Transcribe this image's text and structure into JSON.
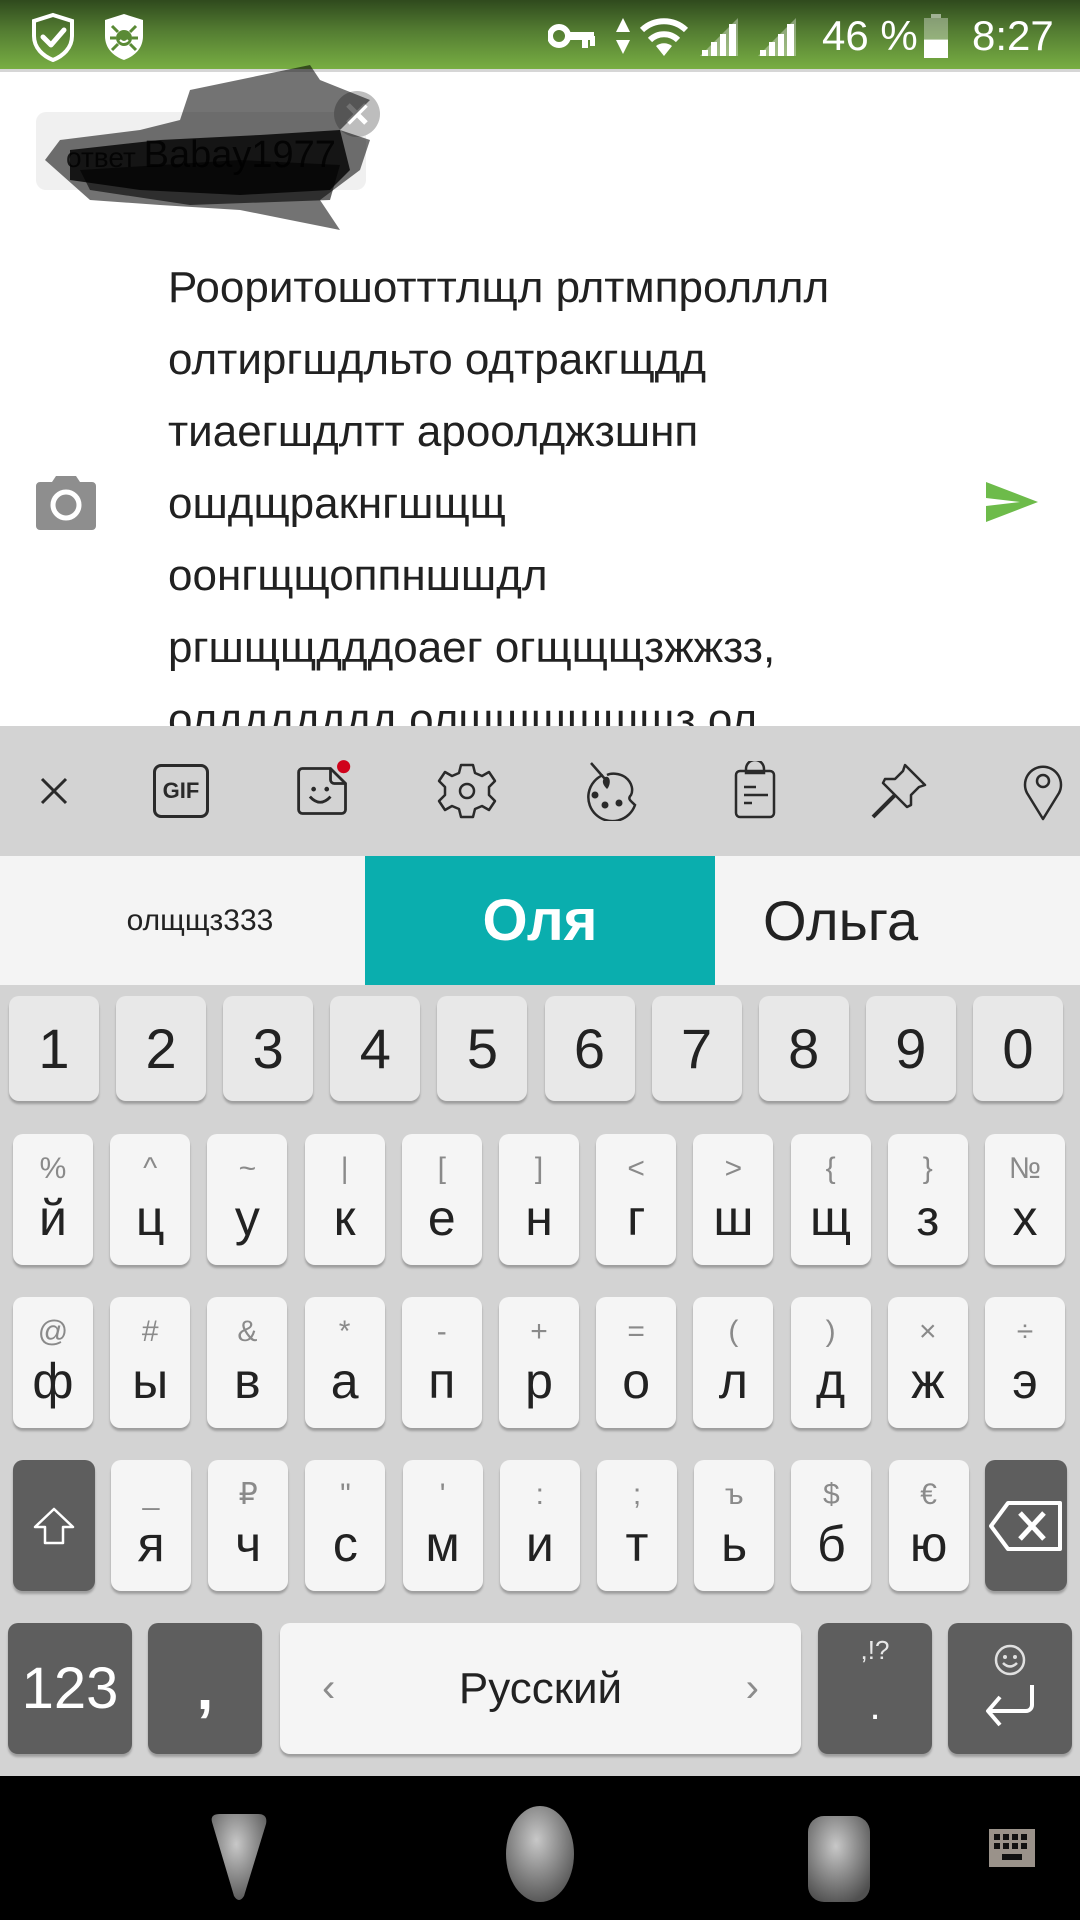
{
  "status_bar": {
    "left_icons": [
      "adguard-shield-icon",
      "drweb-spider-icon"
    ],
    "right_icons": [
      "vpn-key-icon",
      "data-arrows-icon",
      "wifi-icon",
      "signal-sim1-icon",
      "signal-sim2-icon"
    ],
    "battery_percent_text": "46 %",
    "battery_level": 0.46,
    "time": "8:27"
  },
  "compose": {
    "reply_chip": {
      "prefix": "ответ",
      "nickname": "Babay1977",
      "redacted": true
    },
    "message_lines": [
      "Рооритошотттлщл рлтмпролллл",
      "олтиргшдльто одтракгщдд",
      "тиаегшдлтт ароолджзшнп",
      "ошдщракнгшщщ",
      "оонгщщоппншшдл",
      "ргшщщдддоаег огщщщзжжзз,",
      "олддддддд олщщщщщщз ол"
    ],
    "camera_icon": "camera-icon",
    "send_icon": "send-icon",
    "accent_color": "#6dbb4a"
  },
  "keyboard": {
    "toolbar": [
      "close-icon",
      "gif-icon",
      "sticker-icon",
      "settings-icon",
      "theme-palette-icon",
      "clipboard-icon",
      "pin-icon",
      "location-icon"
    ],
    "gif_label": "GIF",
    "sticker_has_notification": true,
    "suggestions": {
      "left": "олщщз333",
      "center": "Оля",
      "right": "Ольга",
      "highlight_color": "#0aaeae"
    },
    "number_row": [
      "1",
      "2",
      "3",
      "4",
      "5",
      "6",
      "7",
      "8",
      "9",
      "0"
    ],
    "row1": [
      {
        "main": "й",
        "hint": "%"
      },
      {
        "main": "ц",
        "hint": "^"
      },
      {
        "main": "у",
        "hint": "~"
      },
      {
        "main": "к",
        "hint": "|"
      },
      {
        "main": "е",
        "hint": "["
      },
      {
        "main": "н",
        "hint": "]"
      },
      {
        "main": "г",
        "hint": "<"
      },
      {
        "main": "ш",
        "hint": ">"
      },
      {
        "main": "щ",
        "hint": "{"
      },
      {
        "main": "з",
        "hint": "}"
      },
      {
        "main": "х",
        "hint": "№"
      }
    ],
    "row2": [
      {
        "main": "ф",
        "hint": "@"
      },
      {
        "main": "ы",
        "hint": "#"
      },
      {
        "main": "в",
        "hint": "&"
      },
      {
        "main": "а",
        "hint": "*"
      },
      {
        "main": "п",
        "hint": "-"
      },
      {
        "main": "р",
        "hint": "+"
      },
      {
        "main": "о",
        "hint": "="
      },
      {
        "main": "л",
        "hint": "("
      },
      {
        "main": "д",
        "hint": ")"
      },
      {
        "main": "ж",
        "hint": "×"
      },
      {
        "main": "э",
        "hint": "÷"
      }
    ],
    "row3": [
      {
        "main": "я",
        "hint": "_"
      },
      {
        "main": "ч",
        "hint": "₽"
      },
      {
        "main": "с",
        "hint": "\""
      },
      {
        "main": "м",
        "hint": "'"
      },
      {
        "main": "и",
        "hint": ":"
      },
      {
        "main": "т",
        "hint": ";"
      },
      {
        "main": "ь",
        "hint": "ъ"
      },
      {
        "main": "б",
        "hint": "$"
      },
      {
        "main": "ю",
        "hint": "€"
      }
    ],
    "shift_icon": "shift-icon",
    "backspace_icon": "backspace-icon",
    "symbols_label": "123",
    "comma_label": ",",
    "space_label": "Русский",
    "space_left_arrow": "‹",
    "space_right_arrow": "›",
    "period_label": ".",
    "period_hint": ",!?",
    "enter_icon": "enter-icon",
    "enter_hint_icon": "emoji-icon"
  },
  "nav_bar": {
    "buttons": [
      "back-icon",
      "home-icon",
      "recents-icon",
      "keyboard-switch-icon"
    ]
  }
}
